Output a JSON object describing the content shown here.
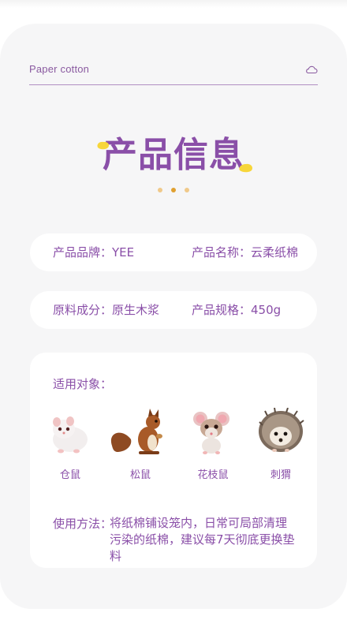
{
  "header": {
    "brand_text": "Paper cotton",
    "icon": "cloud-icon"
  },
  "title": {
    "text": "产品信息"
  },
  "colors": {
    "accent": "#8a4fa8",
    "highlight": "#f7d63a",
    "dot_active": "#e0a030",
    "dot_inactive": "#f0c98a",
    "panel_bg": "#f6f6f7"
  },
  "pager": {
    "count": 3,
    "active_index": 1
  },
  "info": {
    "brand_label": "产品品牌：",
    "brand_value": "YEE",
    "name_label": "产品名称：",
    "name_value": "云柔纸棉",
    "material_label": "原料成分：",
    "material_value": "原生木浆",
    "spec_label": "产品规格：",
    "spec_value": "450g"
  },
  "target": {
    "label": "适用对象：",
    "animals": [
      {
        "name": "仓鼠",
        "icon": "hamster-icon"
      },
      {
        "name": "松鼠",
        "icon": "squirrel-icon"
      },
      {
        "name": "花枝鼠",
        "icon": "fancy-rat-icon"
      },
      {
        "name": "刺猬",
        "icon": "hedgehog-icon"
      }
    ]
  },
  "usage": {
    "label": "使用方法：",
    "text": "将纸棉铺设笼内，日常可局部清理污染的纸棉，建议每7天彻底更换垫料"
  }
}
